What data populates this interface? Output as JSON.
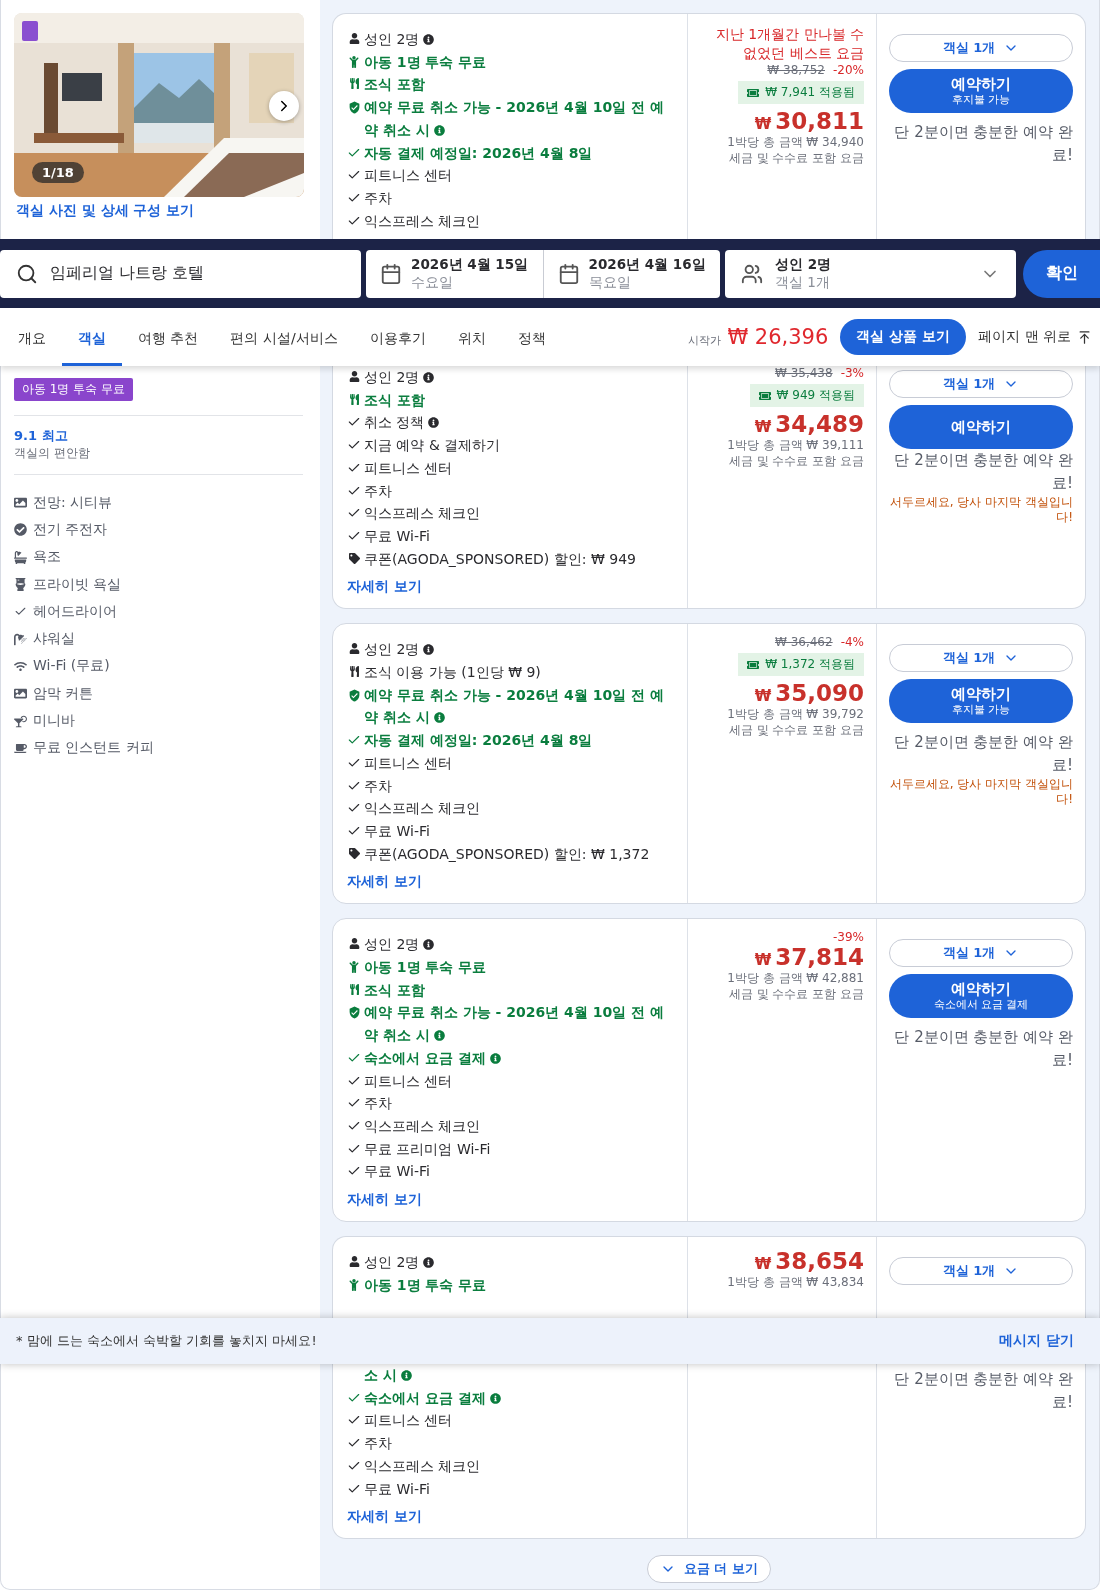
{
  "gallery": {
    "counter": "1/18",
    "link": "객실 사진 및 상세 구성 보기"
  },
  "search": {
    "destination": "임페리얼 나트랑 호텔",
    "checkin": {
      "date": "2026년 4월 15일",
      "day": "수요일"
    },
    "checkout": {
      "date": "2026년 4월 16일",
      "day": "목요일"
    },
    "guests": {
      "main": "성인 2명",
      "sub": "객실 1개"
    },
    "submit": "확인"
  },
  "tabs": [
    {
      "label": "개요",
      "selected": false
    },
    {
      "label": "객실",
      "selected": true
    },
    {
      "label": "여행 추천",
      "selected": false
    },
    {
      "label": "편의 시설/서비스",
      "selected": false
    },
    {
      "label": "이용후기",
      "selected": false
    },
    {
      "label": "위치",
      "selected": false
    },
    {
      "label": "정책",
      "selected": false
    }
  ],
  "price_from": {
    "label": "시작가",
    "currency": "₩",
    "amount": "26,396"
  },
  "view_rooms": "객실 상품 보기",
  "back_to_top": "페이지 맨 위로",
  "sidebar": {
    "badge": "아동 1명 투숙 무료",
    "rating": {
      "score": "9.1 최고",
      "label": "객실의 편안함"
    },
    "amenities": [
      {
        "kind": "view",
        "label": "전망: 시티뷰"
      },
      {
        "kind": "ev",
        "label": "전기 주전자"
      },
      {
        "kind": "bathtub",
        "label": "욕조"
      },
      {
        "kind": "toilet",
        "label": "프라이빗 욕실"
      },
      {
        "kind": "check",
        "label": "헤어드라이어"
      },
      {
        "kind": "shower",
        "label": "샤워실"
      },
      {
        "kind": "wifi",
        "label": "Wi-Fi (무료)"
      },
      {
        "kind": "curtain",
        "label": "암막 커튼"
      },
      {
        "kind": "minibar",
        "label": "미니바"
      },
      {
        "kind": "coffee",
        "label": "무료 인스턴트 커피"
      }
    ]
  },
  "offers": [
    {
      "segments": [
        {
          "features": [
            {
              "kind": "person",
              "text": "성인 2명",
              "emphasis": false,
              "info": true
            },
            {
              "kind": "child",
              "text": "아동 1명 투숙 무료",
              "emphasis": true,
              "info": false
            },
            {
              "kind": "breakfast",
              "text": "조식 포함",
              "emphasis": true,
              "info": false
            },
            {
              "kind": "cancel",
              "text": "예약 무료 취소 가능 - 2026년 4월 10일 전 예약 취소 시",
              "emphasis": true,
              "info": true
            },
            {
              "kind": "check",
              "text": "자동 결제 예정일: 2026년 4월 8일",
              "emphasis": true,
              "info": false
            },
            {
              "kind": "check",
              "text": "피트니스 센터",
              "emphasis": false,
              "info": false
            },
            {
              "kind": "check",
              "text": "주차",
              "emphasis": false,
              "info": false
            },
            {
              "kind": "check",
              "text": "익스프레스 체크인",
              "emphasis": false,
              "info": false
            }
          ],
          "price": {
            "deal_note": "지난 1개월간 만나볼 수 없었던 베스트 요금",
            "original": "₩ 38,752",
            "discount": "-20%",
            "coupon": "₩ 7,941 적용됨",
            "currency": "₩",
            "amount": "30,811",
            "total": "1박당 총 금액 ₩ 34,940",
            "tax_note": "세금 및 수수료 포함 요금"
          },
          "action": {
            "rooms": "객실 1개",
            "book": "예약하기",
            "book_sub": "후지불 가능",
            "note": "단 2분이면 충분한 예약 완료!"
          }
        }
      ]
    },
    {
      "segments": [
        {
          "features": [
            {
              "kind": "person",
              "text": "성인 2명",
              "emphasis": false,
              "info": true
            },
            {
              "kind": "breakfast",
              "text": "조식 포함",
              "emphasis": true,
              "info": false
            },
            {
              "kind": "check",
              "text": "취소 정책",
              "emphasis": false,
              "info": true
            },
            {
              "kind": "check",
              "text": "지금 예약 & 결제하기",
              "emphasis": false,
              "info": false
            },
            {
              "kind": "check",
              "text": "피트니스 센터",
              "emphasis": false,
              "info": false
            },
            {
              "kind": "check",
              "text": "주차",
              "emphasis": false,
              "info": false
            },
            {
              "kind": "check",
              "text": "익스프레스 체크인",
              "emphasis": false,
              "info": false
            },
            {
              "kind": "check",
              "text": "무료 Wi-Fi",
              "emphasis": false,
              "info": false
            },
            {
              "kind": "coupon",
              "text": "쿠폰(AGODA_SPONSORED) 할인: ₩ 949",
              "emphasis": false,
              "info": false
            }
          ],
          "link": "자세히 보기",
          "price": {
            "original": "₩ 35,438",
            "discount": "-3%",
            "coupon": "₩ 949 적용됨",
            "currency": "₩",
            "amount": "34,489",
            "total": "1박당 총 금액 ₩ 39,111",
            "tax_note": "세금 및 수수료 포함 요금"
          },
          "action": {
            "rooms": "객실 1개",
            "book": "예약하기",
            "note": "단 2분이면 충분한 예약 완료!",
            "urgency": "서두르세요, 당사 마지막 객실입니다!"
          }
        }
      ]
    },
    {
      "segments": [
        {
          "features": [
            {
              "kind": "person",
              "text": "성인 2명",
              "emphasis": false,
              "info": true
            },
            {
              "kind": "breakfast_optional",
              "text": "조식 이용 가능 (1인당 ₩ 9)",
              "emphasis": false,
              "info": false
            },
            {
              "kind": "cancel",
              "text": "예약 무료 취소 가능 - 2026년 4월 10일 전 예약 취소 시",
              "emphasis": true,
              "info": true
            },
            {
              "kind": "check",
              "text": "자동 결제 예정일: 2026년 4월 8일",
              "emphasis": true,
              "info": false
            },
            {
              "kind": "check",
              "text": "피트니스 센터",
              "emphasis": false,
              "info": false
            },
            {
              "kind": "check",
              "text": "주차",
              "emphasis": false,
              "info": false
            },
            {
              "kind": "check",
              "text": "익스프레스 체크인",
              "emphasis": false,
              "info": false
            },
            {
              "kind": "check",
              "text": "무료 Wi-Fi",
              "emphasis": false,
              "info": false
            },
            {
              "kind": "coupon",
              "text": "쿠폰(AGODA_SPONSORED) 할인: ₩ 1,372",
              "emphasis": false,
              "info": false
            }
          ],
          "link": "자세히 보기",
          "price": {
            "original": "₩ 36,462",
            "discount": "-4%",
            "coupon": "₩ 1,372 적용됨",
            "currency": "₩",
            "amount": "35,090",
            "total": "1박당 총 금액 ₩ 39,792",
            "tax_note": "세금 및 수수료 포함 요금"
          },
          "action": {
            "rooms": "객실 1개",
            "book": "예약하기",
            "book_sub": "후지불 가능",
            "note": "단 2분이면 충분한 예약 완료!",
            "urgency": "서두르세요, 당사 마지막 객실입니다!"
          }
        }
      ]
    },
    {
      "segments": [
        {
          "features": [
            {
              "kind": "person",
              "text": "성인 2명",
              "emphasis": false,
              "info": true
            },
            {
              "kind": "child",
              "text": "아동 1명 투숙 무료",
              "emphasis": true,
              "info": false
            },
            {
              "kind": "breakfast",
              "text": "조식 포함",
              "emphasis": true,
              "info": false
            },
            {
              "kind": "cancel",
              "text": "예약 무료 취소 가능 - 2026년 4월 10일 전 예약 취소 시",
              "emphasis": true,
              "info": true
            },
            {
              "kind": "check",
              "text": "숙소에서 요금 결제",
              "emphasis": true,
              "info": true
            },
            {
              "kind": "check",
              "text": "피트니스 센터",
              "emphasis": false,
              "info": false
            },
            {
              "kind": "check",
              "text": "주차",
              "emphasis": false,
              "info": false
            },
            {
              "kind": "check",
              "text": "익스프레스 체크인",
              "emphasis": false,
              "info": false
            },
            {
              "kind": "check",
              "text": "무료 프리미엄 Wi-Fi",
              "emphasis": false,
              "info": false
            },
            {
              "kind": "check",
              "text": "무료 Wi-Fi",
              "emphasis": false,
              "info": false
            }
          ],
          "link": "자세히 보기",
          "price": {
            "discount": "-39%",
            "currency": "₩",
            "amount": "37,814",
            "total": "1박당 총 금액 ₩ 42,881",
            "tax_note": "세금 및 수수료 포함 요금"
          },
          "action": {
            "rooms": "객실 1개",
            "book": "예약하기",
            "book_sub": "숙소에서 요금 결제",
            "note": "단 2분이면 충분한 예약 완료!"
          }
        }
      ]
    },
    {
      "segments": [
        {
          "features": [
            {
              "kind": "person",
              "text": "성인 2명",
              "emphasis": false,
              "info": true
            },
            {
              "kind": "child",
              "text": "아동 1명 투숙 무료",
              "emphasis": true,
              "info": false
            }
          ],
          "price": {
            "currency": "₩",
            "amount": "38,654",
            "total": "1박당 총 금액 ₩ 43,834"
          },
          "action": {
            "rooms": "객실 1개"
          }
        },
        {
          "features": [
            {
              "kind": "continuation",
              "text": "소 시",
              "emphasis": true,
              "info": true
            },
            {
              "kind": "check",
              "text": "숙소에서 요금 결제",
              "emphasis": true,
              "info": true
            },
            {
              "kind": "check",
              "text": "피트니스 센터",
              "emphasis": false,
              "info": false
            },
            {
              "kind": "check",
              "text": "주차",
              "emphasis": false,
              "info": false
            },
            {
              "kind": "check",
              "text": "익스프레스 체크인",
              "emphasis": false,
              "info": false
            },
            {
              "kind": "check",
              "text": "무료 Wi-Fi",
              "emphasis": false,
              "info": false
            }
          ],
          "link": "자세히 보기",
          "action": {
            "note": "단 2분이면 충분한 예약 완료!"
          }
        }
      ]
    }
  ],
  "banner": {
    "text": "* 맘에 드는 숙소에서 숙박할 기회를 놓치지 마세요!",
    "close": "메시지 닫기"
  },
  "more_button": "요금 더 보기"
}
